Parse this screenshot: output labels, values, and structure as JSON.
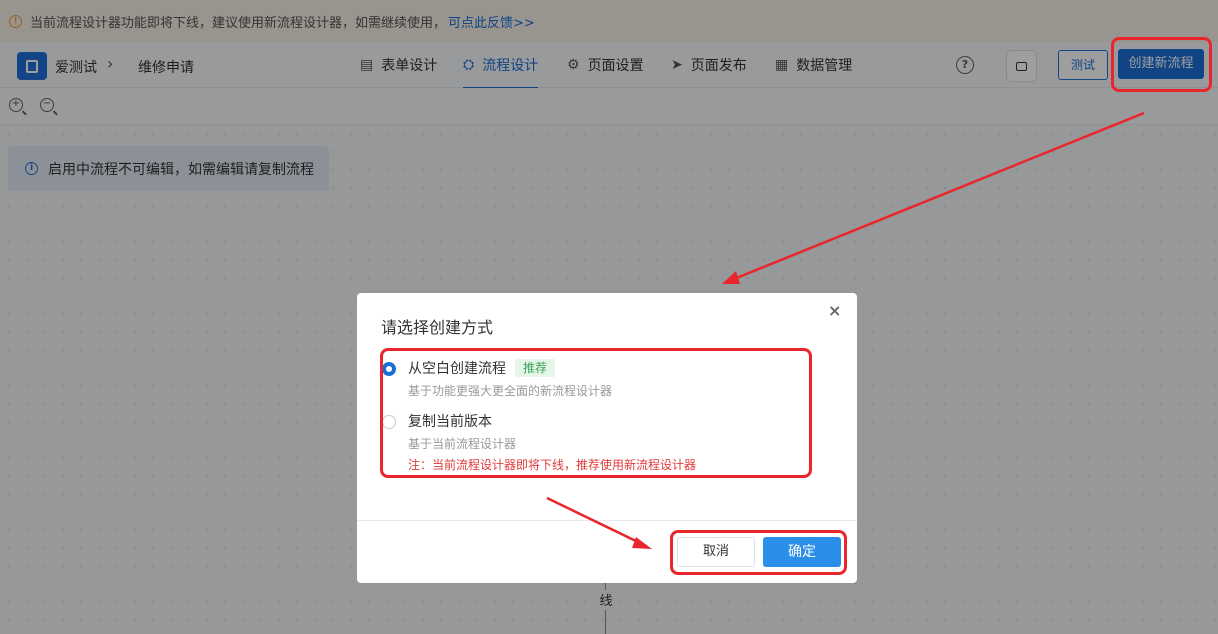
{
  "banner": {
    "text": "当前流程设计器功能即将下线，建议使用新流程设计器，如需继续使用，",
    "link": "可点此反馈>>"
  },
  "header": {
    "breadcrumb": [
      "爱测试",
      "维修申请"
    ],
    "tabs": [
      {
        "label": "表单设计",
        "icon": "document-icon"
      },
      {
        "label": "流程设计",
        "icon": "flow-icon",
        "active": true
      },
      {
        "label": "页面设置",
        "icon": "gear-icon"
      },
      {
        "label": "页面发布",
        "icon": "send-icon"
      },
      {
        "label": "数据管理",
        "icon": "table-icon"
      }
    ],
    "help_label": "?",
    "test_label": "测试",
    "create_label": "创建新流程"
  },
  "toolbar": {
    "zoom_in": "+",
    "zoom_out": "−"
  },
  "canvas": {
    "info_text": "启用中流程不可编辑，如需编辑请复制流程",
    "flow_label": "线"
  },
  "modal": {
    "title": "请选择创建方式",
    "close": "×",
    "options": [
      {
        "title": "从空白创建流程",
        "badge": "推荐",
        "desc": "基于功能更强大更全面的新流程设计器",
        "checked": true
      },
      {
        "title": "复制当前版本",
        "desc": "基于当前流程设计器",
        "note": "注：当前流程设计器即将下线，推荐使用新流程设计器",
        "checked": false
      }
    ],
    "cancel_label": "取消",
    "ok_label": "确定"
  },
  "colors": {
    "accent": "#1a6fd6",
    "annotation": "#e8262b",
    "warning": "#f0a040"
  }
}
